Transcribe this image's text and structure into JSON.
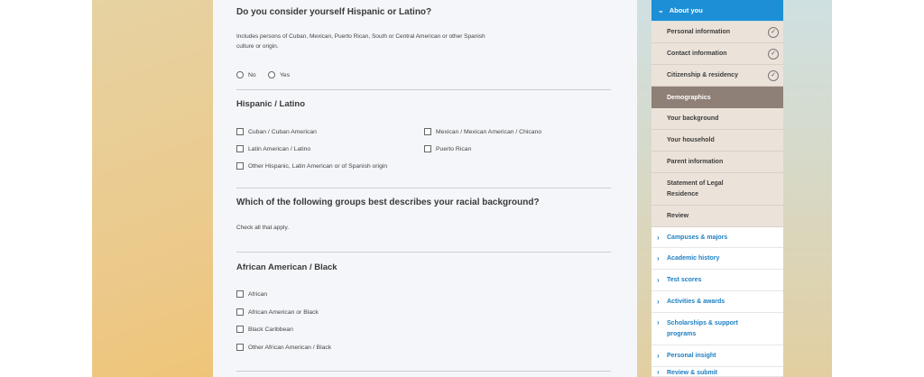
{
  "form": {
    "q1": {
      "title": "Do you consider yourself Hispanic or Latino?",
      "help_line1": "Includes persons of Cuban, Mexican, Puerto Rican, South or Central American or other Spanish",
      "help_line2": "culture or origin.",
      "options": [
        "No",
        "Yes"
      ]
    },
    "hispanic": {
      "heading": "Hispanic / Latino",
      "options": [
        "Cuban / Cuban American",
        "Mexican / Mexican American / Chicano",
        "Latin American / Latino",
        "Puerto Rican",
        "Other Hispanic, Latin American or of Spanish origin"
      ]
    },
    "q2": {
      "title": "Which of the following groups best describes your racial background?",
      "help": "Check all that apply."
    },
    "african": {
      "heading": "African American / Black",
      "options": [
        "African",
        "African American or Black",
        "Black Caribbean",
        "Other African American / Black"
      ]
    }
  },
  "nav": {
    "current_section": "About you",
    "subitems": [
      {
        "label": "Personal information",
        "complete": true
      },
      {
        "label": "Contact information",
        "complete": true
      },
      {
        "label": "Citizenship & residency",
        "complete": true
      },
      {
        "label": "Demographics",
        "active": true
      },
      {
        "label": "Your background"
      },
      {
        "label": "Your household"
      },
      {
        "label": "Parent information"
      },
      {
        "label": "Statement of Legal",
        "label2": "Residence"
      },
      {
        "label": "Review"
      }
    ],
    "sections": [
      "Campuses & majors",
      "Academic history",
      "Test scores",
      "Activities & awards",
      "Scholarships & support",
      "programs",
      "Personal insight",
      "Review & submit"
    ]
  },
  "colors": {
    "accent": "#1c8fd6",
    "active_bg": "#8e7f77",
    "subitem_bg": "#ebe3da"
  }
}
